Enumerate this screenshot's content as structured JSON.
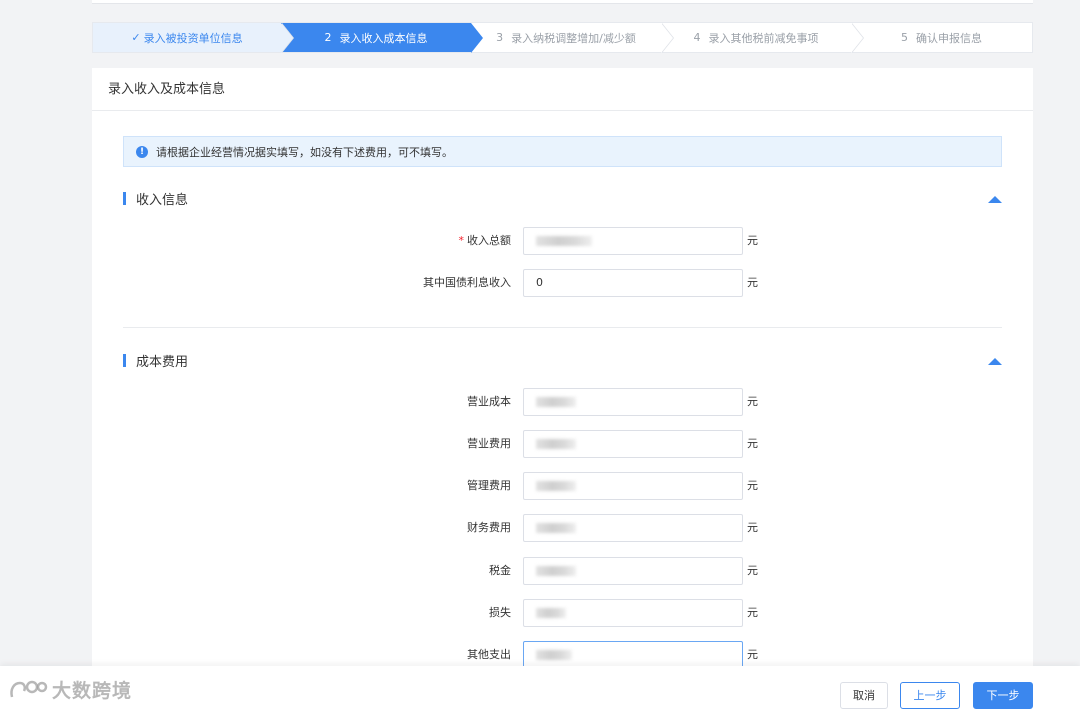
{
  "steps": [
    {
      "num": "",
      "label": "录入被投资单位信息",
      "state": "done"
    },
    {
      "num": "2",
      "label": "录入收入成本信息",
      "state": "active"
    },
    {
      "num": "3",
      "label": "录入纳税调整增加/减少额",
      "state": "pending"
    },
    {
      "num": "4",
      "label": "录入其他税前减免事项",
      "state": "pending"
    },
    {
      "num": "5",
      "label": "确认申报信息",
      "state": "pending"
    }
  ],
  "card": {
    "title": "录入收入及成本信息",
    "notice": "请根据企业经营情况据实填写，如没有下述费用，可不填写。",
    "notice_icon": "!"
  },
  "income": {
    "title": "收入信息",
    "rows": [
      {
        "label": "收入总额",
        "required_mark": "*",
        "value": "",
        "unit": "元"
      },
      {
        "label": "其中国债利息收入",
        "value": "0",
        "unit": "元"
      }
    ]
  },
  "cost": {
    "title": "成本费用",
    "rows": [
      {
        "label": "营业成本",
        "value": "",
        "unit": "元"
      },
      {
        "label": "营业费用",
        "value": "",
        "unit": "元"
      },
      {
        "label": "管理费用",
        "value": "",
        "unit": "元"
      },
      {
        "label": "财务费用",
        "value": "",
        "unit": "元"
      },
      {
        "label": "税金",
        "value": "",
        "unit": "元"
      },
      {
        "label": "损失",
        "value": "",
        "unit": "元"
      },
      {
        "label": "其他支出",
        "value": "",
        "unit": "元"
      }
    ]
  },
  "footer": {
    "cancel": "取消",
    "prev": "上一步",
    "next": "下一步"
  },
  "watermark": "大数跨境",
  "colors": {
    "accent": "#3b87ee",
    "required": "#f5222d",
    "notice_bg": "#e9f3fd"
  }
}
